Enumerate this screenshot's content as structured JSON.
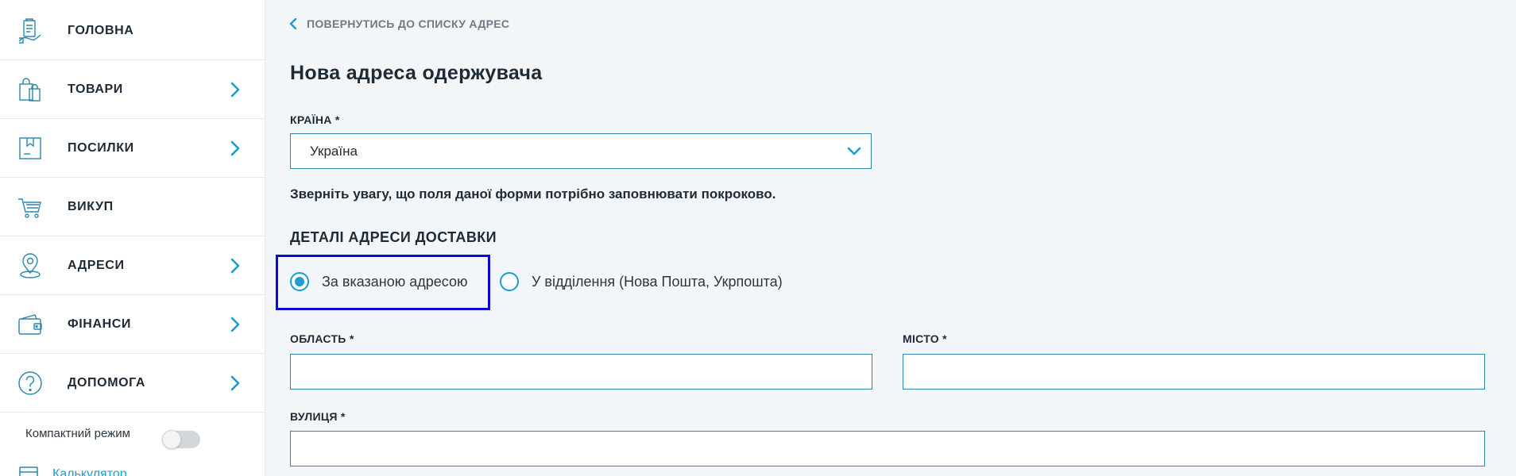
{
  "sidebar": {
    "items": [
      {
        "label": "ГОЛОВНА",
        "icon": "home-icon",
        "has_chevron": false
      },
      {
        "label": "ТОВАРИ",
        "icon": "shopping-bags-icon",
        "has_chevron": true
      },
      {
        "label": "ПОСИЛКИ",
        "icon": "package-icon",
        "has_chevron": true
      },
      {
        "label": "ВИКУП",
        "icon": "cart-icon",
        "has_chevron": false
      },
      {
        "label": "АДРЕСИ",
        "icon": "location-pin-icon",
        "has_chevron": true
      },
      {
        "label": "ФІНАНСИ",
        "icon": "wallet-icon",
        "has_chevron": true
      },
      {
        "label": "ДОПОМОГА",
        "icon": "help-icon",
        "has_chevron": true
      }
    ],
    "compact_mode_label": "Компактний режим",
    "compact_mode_on": false,
    "calculator_label": "Калькулятор"
  },
  "main": {
    "back_link": "ПОВЕРНУТИСЬ ДО СПИСКУ АДРЕС",
    "title": "Нова адреса одержувача",
    "country": {
      "label": "КРАЇНА *",
      "value": "Україна"
    },
    "notice": "Зверніть увагу, що поля даної форми потрібно заповнювати покроково.",
    "section_title": "ДЕТАЛІ АДРЕСИ ДОСТАВКИ",
    "delivery_options": [
      {
        "label": "За вказаною адресою",
        "checked": true
      },
      {
        "label": "У відділення (Нова Пошта, Укрпошта)",
        "checked": false
      }
    ],
    "region": {
      "label": "ОБЛАСТЬ *",
      "value": ""
    },
    "city": {
      "label": "МІСТО *",
      "value": ""
    },
    "street": {
      "label": "ВУЛИЦЯ *",
      "value": ""
    }
  },
  "colors": {
    "accent": "#1e9bd1",
    "input_border": "#2e86ab",
    "highlight": "#0a0ad6",
    "background": "#f2f6f8"
  }
}
